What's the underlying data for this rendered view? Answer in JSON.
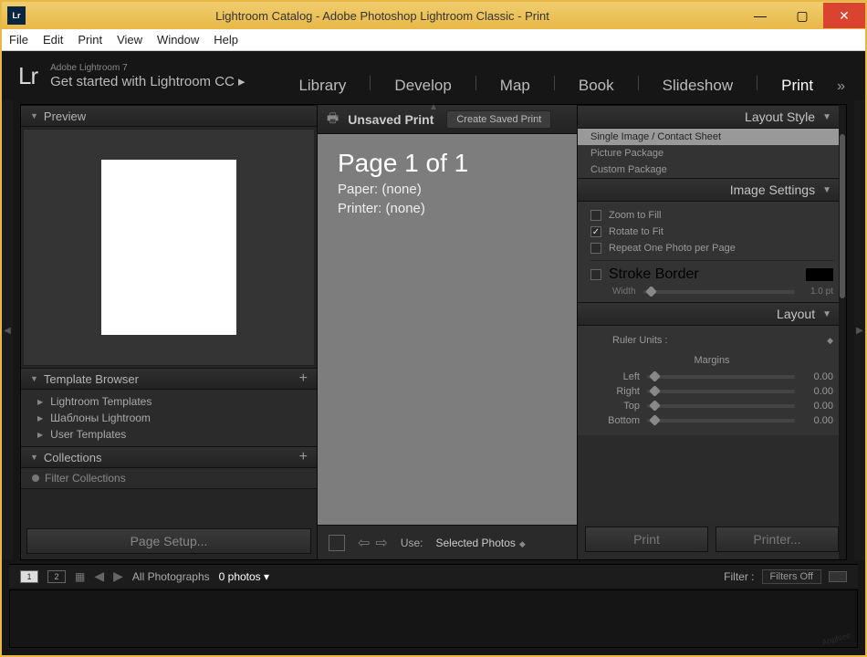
{
  "titlebar": {
    "icon_text": "Lr",
    "title": "Lightroom Catalog - Adobe Photoshop Lightroom Classic - Print"
  },
  "menu": [
    "File",
    "Edit",
    "Print",
    "View",
    "Window",
    "Help"
  ],
  "identity": {
    "small": "Adobe Lightroom 7",
    "big": "Get started with Lightroom CC ▸"
  },
  "modules": [
    "Library",
    "Develop",
    "Map",
    "Book",
    "Slideshow",
    "Print"
  ],
  "active_module": "Print",
  "left": {
    "preview": "Preview",
    "template_browser": "Template Browser",
    "templates": [
      "Lightroom Templates",
      "Шаблоны Lightroom",
      "User Templates"
    ],
    "collections": "Collections",
    "filter_collections": "Filter Collections",
    "page_setup": "Page Setup..."
  },
  "center": {
    "unsaved": "Unsaved Print",
    "create_saved": "Create Saved Print",
    "page_title": "Page 1 of 1",
    "paper": "Paper:  (none)",
    "printer": "Printer:  (none)",
    "use_label": "Use:",
    "use_value": "Selected Photos"
  },
  "right": {
    "layout_style": "Layout Style",
    "styles": [
      "Single Image / Contact Sheet",
      "Picture Package",
      "Custom Package"
    ],
    "image_settings": "Image Settings",
    "zoom_to_fill": "Zoom to Fill",
    "rotate_to_fit": "Rotate to Fit",
    "repeat": "Repeat One Photo per Page",
    "stroke_border": "Stroke Border",
    "width_label": "Width",
    "width_value": "1.0 pt",
    "layout": "Layout",
    "ruler_units": "Ruler Units :",
    "margins": "Margins",
    "margin_labels": [
      "Left",
      "Right",
      "Top",
      "Bottom"
    ],
    "margin_values": [
      "0.00",
      "0.00",
      "0.00",
      "0.00"
    ],
    "print": "Print",
    "printer_btn": "Printer..."
  },
  "filmstrip": {
    "view1": "1",
    "view2": "2",
    "collection": "All Photographs",
    "count": "0 photos",
    "filter_label": "Filter :",
    "filter_value": "Filters Off"
  }
}
